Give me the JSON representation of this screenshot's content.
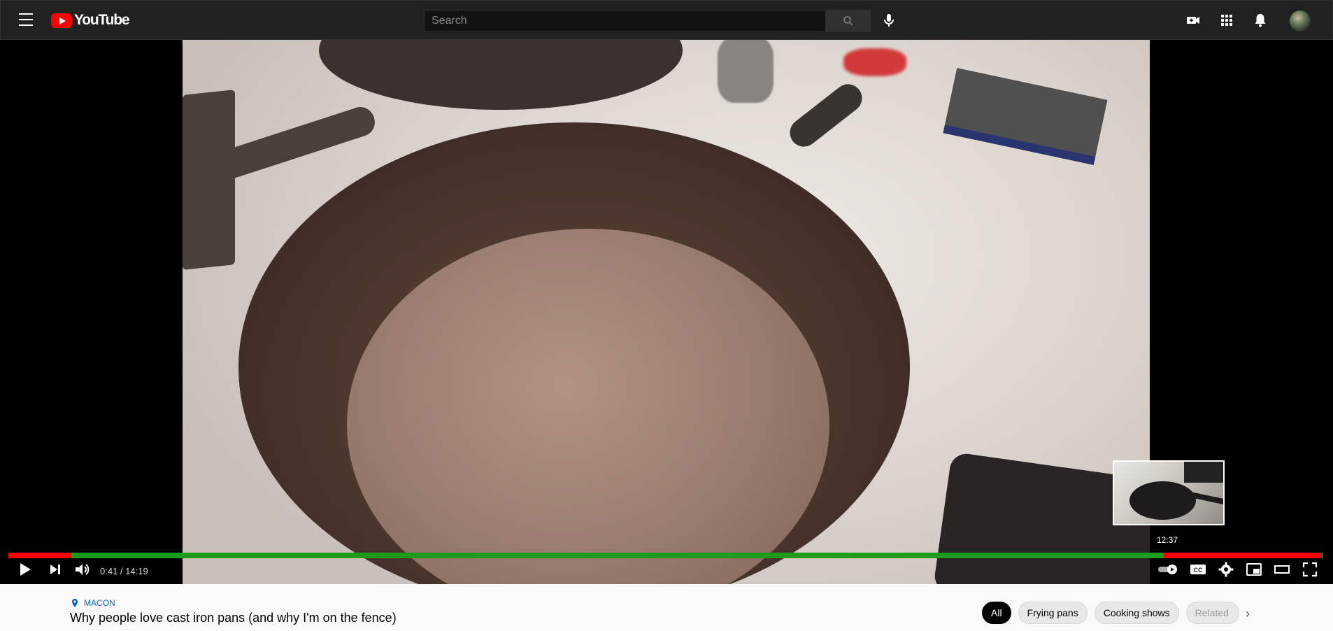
{
  "brand": {
    "name": "YouTube",
    "accent": "#ff0000"
  },
  "search": {
    "placeholder": "Search"
  },
  "player": {
    "current_time": "0:41",
    "separator": " / ",
    "duration": "14:19",
    "time_display": "0:41 / 14:19",
    "progress_fraction": 0.048,
    "preview_time": "12:37"
  },
  "video": {
    "location": "MACON",
    "title": "Why people love cast iron pans (and why I'm on the fence)"
  },
  "chips": [
    {
      "label": "All"
    },
    {
      "label": "Frying pans"
    },
    {
      "label": "Cooking shows"
    },
    {
      "label": "Related"
    }
  ],
  "icons": {
    "menu": "hamburger-icon",
    "search": "search-icon",
    "mic": "microphone-icon",
    "create": "video-camera-plus-icon",
    "apps": "apps-grid-icon",
    "notifications": "bell-icon",
    "play": "play-icon",
    "next": "next-icon",
    "volume": "volume-icon",
    "autoplay": "autoplay-toggle-icon",
    "captions": "cc-icon",
    "settings": "gear-icon",
    "miniplayer": "miniplayer-icon",
    "theater": "theater-mode-icon",
    "fullscreen": "fullscreen-icon"
  }
}
